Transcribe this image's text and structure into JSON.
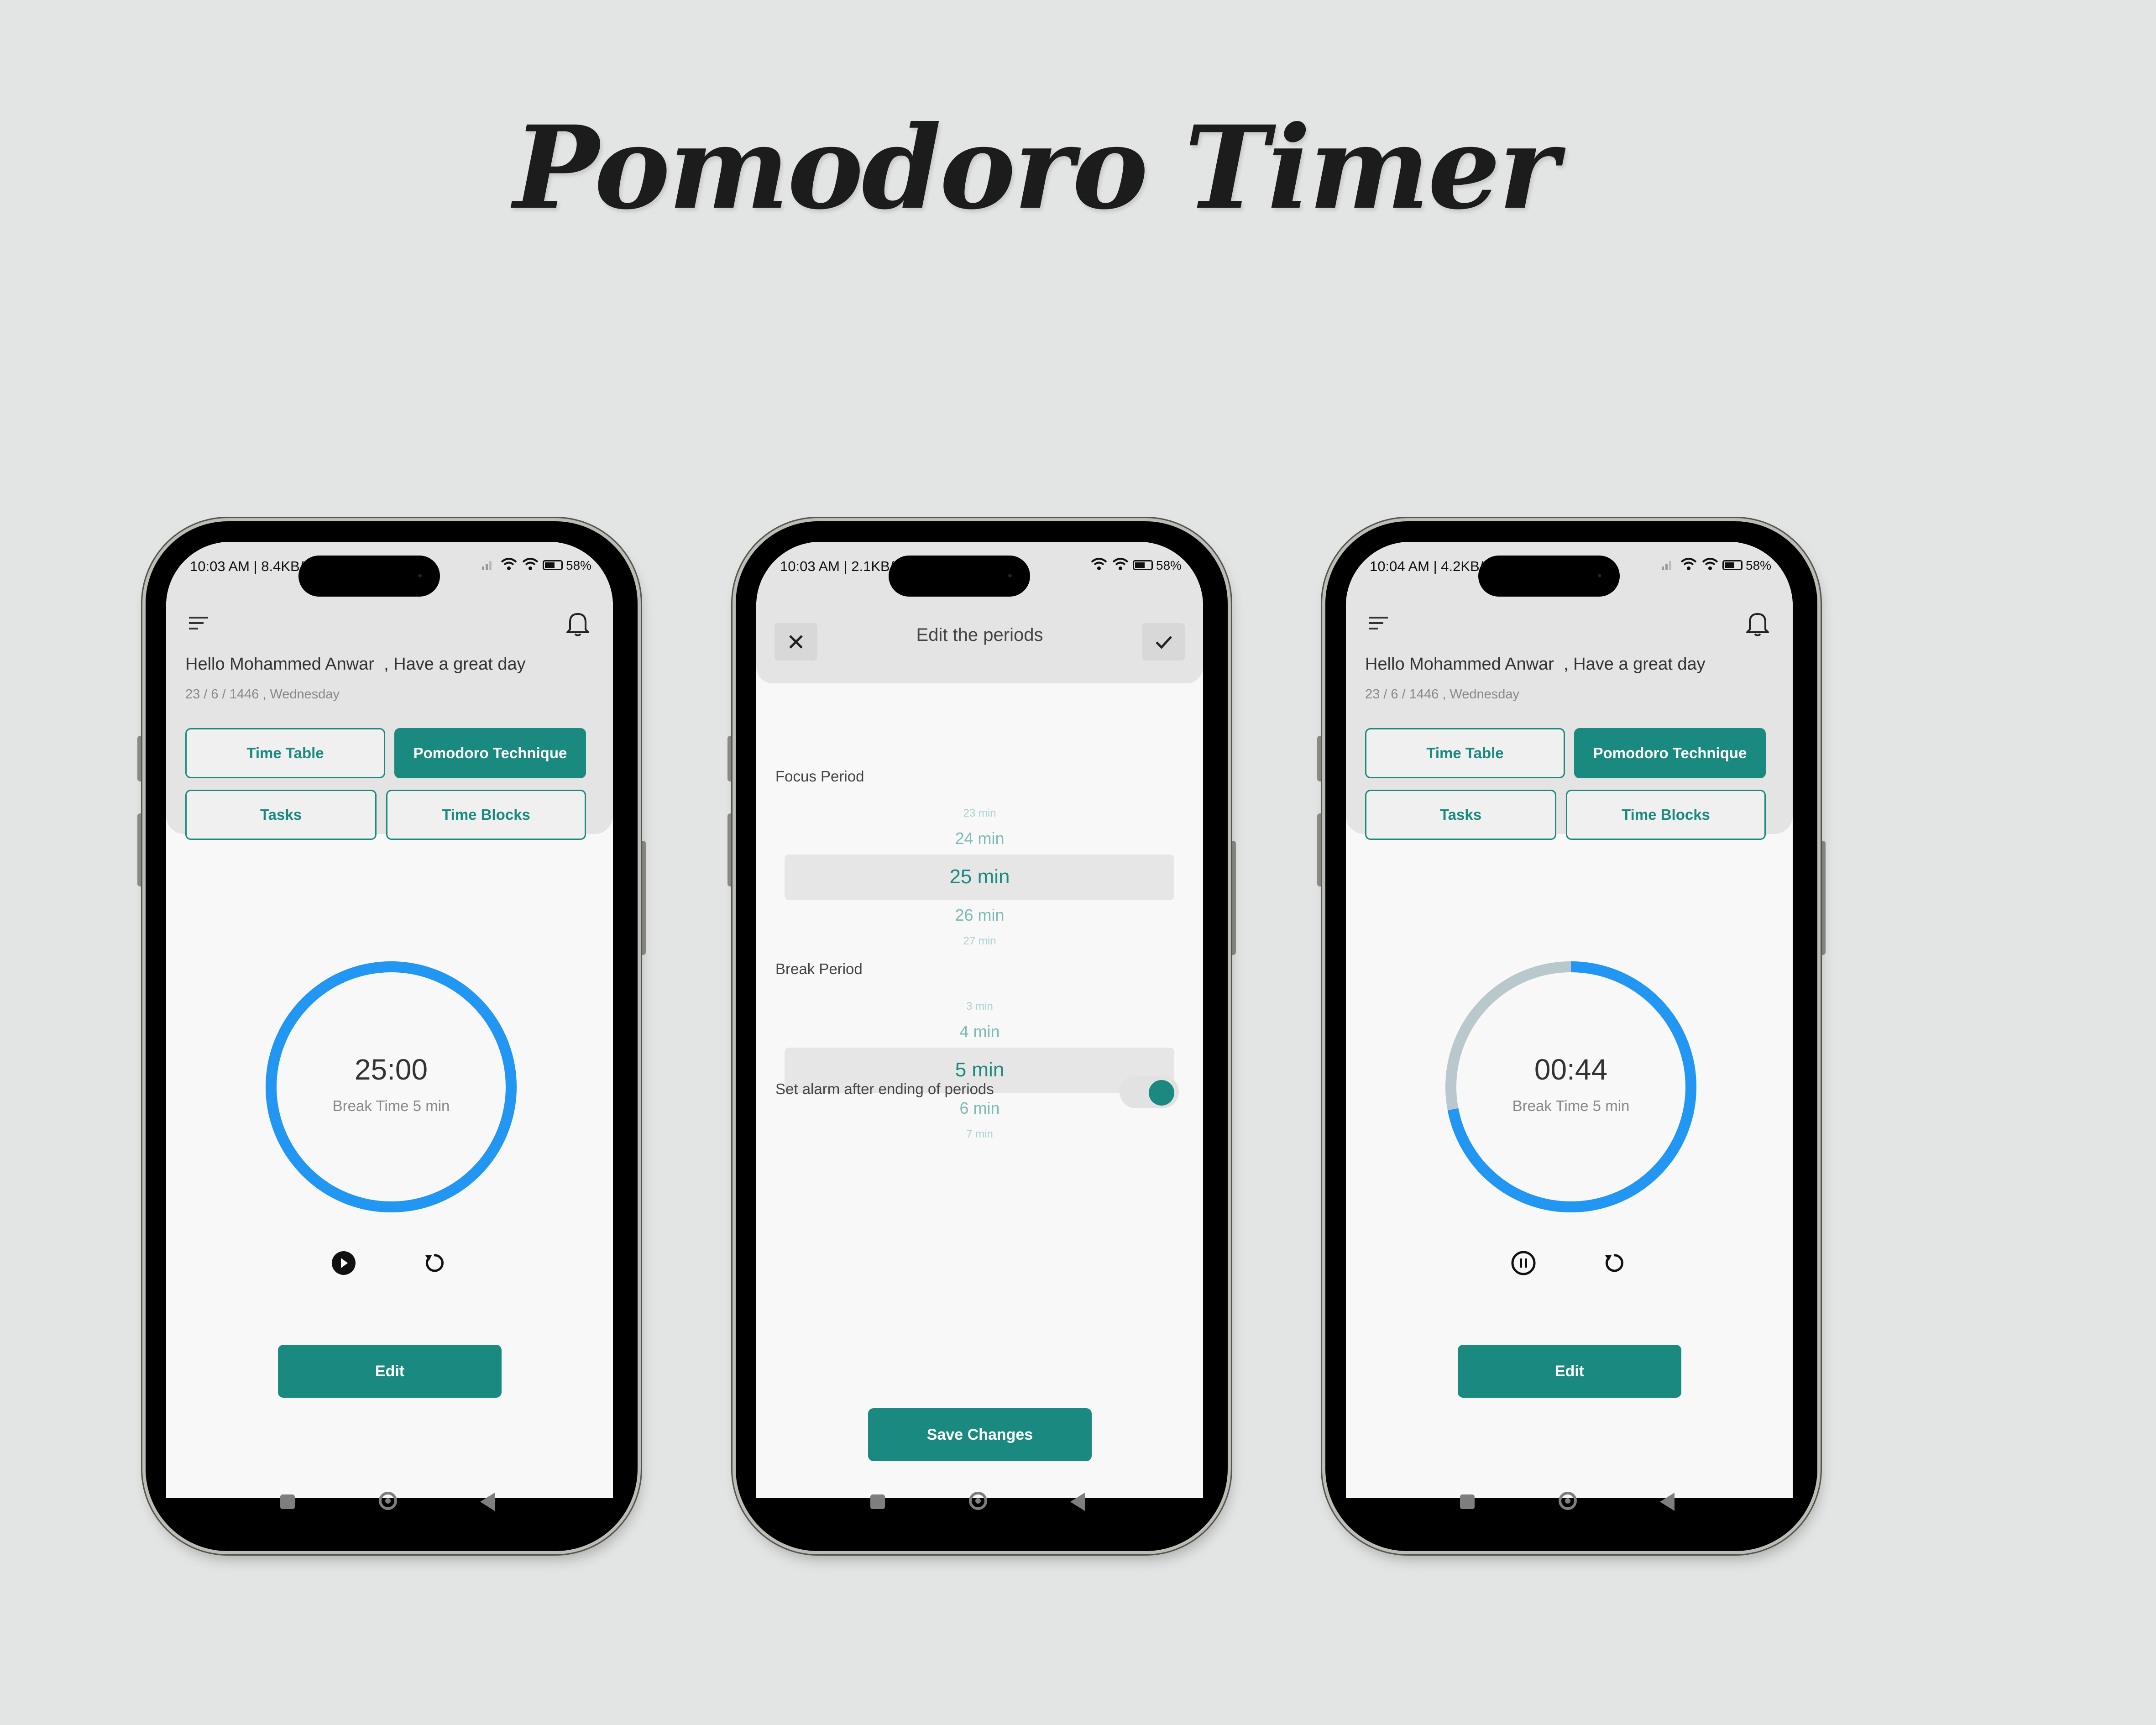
{
  "page": {
    "title": "Pomodoro Timer"
  },
  "colors": {
    "accent": "#1a8a80",
    "ring": "#2196f3",
    "ring_track": "#b8c8cc",
    "background": "#e3e5e4"
  },
  "phones": [
    {
      "status": {
        "text": "10:03 AM | 8.4KB/s",
        "battery": "58"
      },
      "greeting": "Hello Mohammed Anwar  , Have a great day",
      "date": "23 / 6 / 1446 , Wednesday",
      "tabs": {
        "time_table": "Time Table",
        "pomodoro": "Pomodoro Technique",
        "tasks": "Tasks",
        "time_blocks": "Time Blocks"
      },
      "timer": {
        "time": "25:00",
        "subtitle": "Break Time 5 min",
        "progress": 1.0,
        "state": "play"
      },
      "edit_label": "Edit"
    },
    {
      "status": {
        "text": "10:03 AM | 2.1KB/s",
        "battery": "58"
      },
      "title": "Edit the periods",
      "focus": {
        "label": "Focus Period",
        "values": [
          "23",
          "24",
          "25",
          "26",
          "27"
        ],
        "unit": "min",
        "selected": "25"
      },
      "break": {
        "label": "Break Period",
        "values": [
          "3",
          "4",
          "5",
          "6",
          "7"
        ],
        "unit": "min",
        "selected": "5"
      },
      "alarm_label": "Set alarm after ending of periods",
      "alarm_on": true,
      "save_label": "Save Changes"
    },
    {
      "status": {
        "text": "10:04 AM | 4.2KB/s",
        "battery": "58"
      },
      "greeting": "Hello Mohammed Anwar  , Have a great day",
      "date": "23 / 6 / 1446 , Wednesday",
      "tabs": {
        "time_table": "Time Table",
        "pomodoro": "Pomodoro Technique",
        "tasks": "Tasks",
        "time_blocks": "Time Blocks"
      },
      "timer": {
        "time": "00:44",
        "subtitle": "Break Time 5 min",
        "progress": 0.72,
        "state": "pause"
      },
      "edit_label": "Edit"
    }
  ]
}
